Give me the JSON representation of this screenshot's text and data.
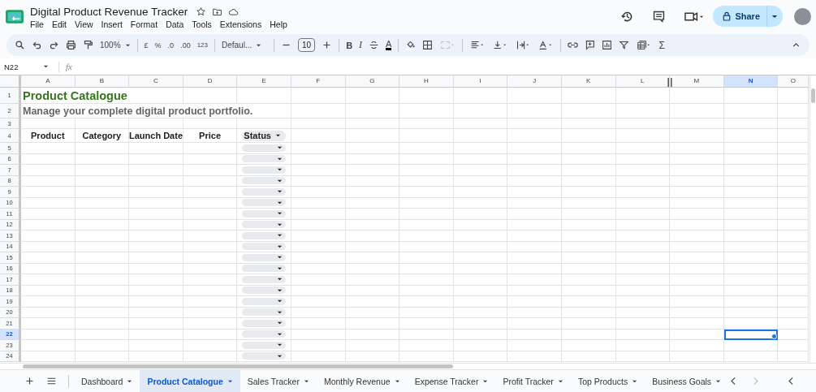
{
  "document": {
    "title": "Digital Product Revenue Tracker"
  },
  "menu": [
    "File",
    "Edit",
    "View",
    "Insert",
    "Format",
    "Data",
    "Tools",
    "Extensions",
    "Help"
  ],
  "share_button": {
    "label": "Share"
  },
  "toolbar": {
    "zoom": "100%",
    "currency": "£",
    "percent": "%",
    "decrease_decimal": ".0",
    "increase_decimal": ".00",
    "number_format": "123",
    "font": "Defaul...",
    "font_size": "10",
    "bold": "B",
    "italic": "I",
    "text_color": "A",
    "functions": "Σ"
  },
  "formula_bar": {
    "name_box": "N22",
    "fx": "fx"
  },
  "columns": [
    {
      "label": "A",
      "selected": false
    },
    {
      "label": "B",
      "selected": false
    },
    {
      "label": "C",
      "selected": false
    },
    {
      "label": "D",
      "selected": false
    },
    {
      "label": "E",
      "selected": false
    },
    {
      "label": "F",
      "selected": false
    },
    {
      "label": "G",
      "selected": false
    },
    {
      "label": "H",
      "selected": false
    },
    {
      "label": "I",
      "selected": false
    },
    {
      "label": "J",
      "selected": false
    },
    {
      "label": "K",
      "selected": false
    },
    {
      "label": "L",
      "selected": false
    },
    {
      "label": "M",
      "selected": false
    },
    {
      "label": "N",
      "selected": true
    },
    {
      "label": "O",
      "selected": false
    }
  ],
  "sheet": {
    "title": "Product Catalogue",
    "subtitle": "Manage your complete digital product portfolio.",
    "headers": [
      {
        "text": "Product",
        "kind": "plain"
      },
      {
        "text": "Category",
        "kind": "plain"
      },
      {
        "text": "Launch Date",
        "kind": "plain"
      },
      {
        "text": "Price",
        "kind": "plain"
      },
      {
        "text": "Status",
        "kind": "dropdown"
      }
    ]
  },
  "rows": [
    {
      "number": "1",
      "selected": false,
      "dropdown": false
    },
    {
      "number": "2",
      "selected": false,
      "dropdown": false
    },
    {
      "number": "3",
      "selected": false,
      "dropdown": false
    },
    {
      "number": "4",
      "selected": false,
      "dropdown": false
    },
    {
      "number": "5",
      "selected": false,
      "dropdown": true
    },
    {
      "number": "6",
      "selected": false,
      "dropdown": true
    },
    {
      "number": "7",
      "selected": false,
      "dropdown": true
    },
    {
      "number": "8",
      "selected": false,
      "dropdown": true
    },
    {
      "number": "9",
      "selected": false,
      "dropdown": true
    },
    {
      "number": "10",
      "selected": false,
      "dropdown": true
    },
    {
      "number": "11",
      "selected": false,
      "dropdown": true
    },
    {
      "number": "12",
      "selected": false,
      "dropdown": true
    },
    {
      "number": "13",
      "selected": false,
      "dropdown": true
    },
    {
      "number": "14",
      "selected": false,
      "dropdown": true
    },
    {
      "number": "15",
      "selected": false,
      "dropdown": true
    },
    {
      "number": "16",
      "selected": false,
      "dropdown": true
    },
    {
      "number": "17",
      "selected": false,
      "dropdown": true
    },
    {
      "number": "18",
      "selected": false,
      "dropdown": true
    },
    {
      "number": "19",
      "selected": false,
      "dropdown": true
    },
    {
      "number": "20",
      "selected": false,
      "dropdown": true
    },
    {
      "number": "21",
      "selected": false,
      "dropdown": true
    },
    {
      "number": "22",
      "selected": true,
      "dropdown": true
    },
    {
      "number": "23",
      "selected": false,
      "dropdown": true
    },
    {
      "number": "24",
      "selected": false,
      "dropdown": true
    }
  ],
  "sheet_tabs": [
    {
      "label": "Dashboard",
      "selected": false
    },
    {
      "label": "Product Catalogue",
      "selected": true
    },
    {
      "label": "Sales Tracker",
      "selected": false
    },
    {
      "label": "Monthly Revenue",
      "selected": false
    },
    {
      "label": "Expense Tracker",
      "selected": false
    },
    {
      "label": "Profit Tracker",
      "selected": false
    },
    {
      "label": "Top Products",
      "selected": false
    },
    {
      "label": "Business Goals",
      "selected": false
    }
  ]
}
